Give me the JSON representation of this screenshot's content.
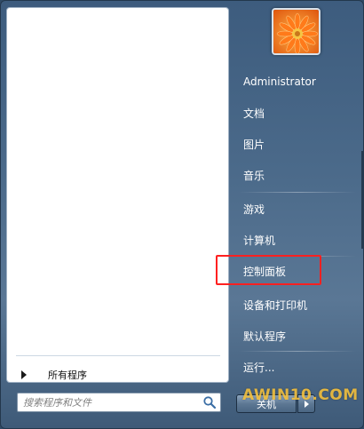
{
  "search": {
    "placeholder": "搜索程序和文件"
  },
  "left_pane": {
    "all_programs_label": "所有程序"
  },
  "user": {
    "name": "Administrator"
  },
  "right_items": [
    "文档",
    "图片",
    "音乐",
    "游戏",
    "计算机",
    "控制面板",
    "设备和打印机",
    "默认程序",
    "运行..."
  ],
  "shutdown": {
    "label": "关机"
  },
  "watermark": "AWIN10.COM",
  "colors": {
    "highlight": "#ff2020",
    "menu_bg": "#4b6a8a"
  }
}
